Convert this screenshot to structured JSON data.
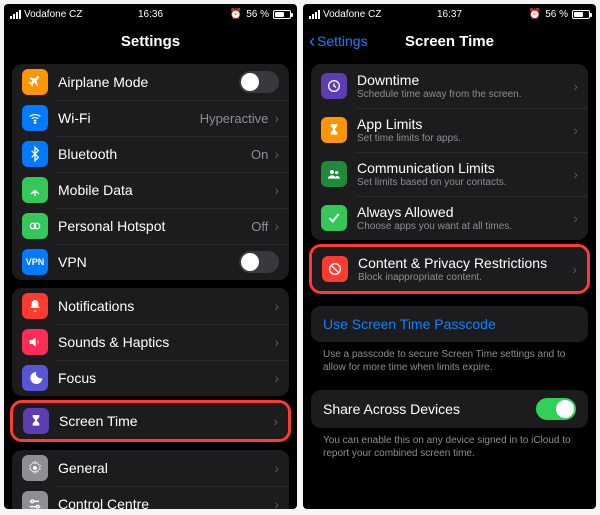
{
  "left": {
    "status": {
      "carrier": "Vodafone CZ",
      "time": "16:36",
      "battery_pct": "56 %"
    },
    "nav_title": "Settings",
    "group1": [
      {
        "icon": "airplane",
        "label": "Airplane Mode",
        "toggle": false
      },
      {
        "icon": "wifi",
        "label": "Wi-Fi",
        "value": "Hyperactive"
      },
      {
        "icon": "bluetooth",
        "label": "Bluetooth",
        "value": "On"
      },
      {
        "icon": "mobiledata",
        "label": "Mobile Data"
      },
      {
        "icon": "hotspot",
        "label": "Personal Hotspot",
        "value": "Off"
      },
      {
        "icon": "vpn",
        "label": "VPN",
        "toggle": false
      }
    ],
    "group2": [
      {
        "icon": "notify",
        "label": "Notifications"
      },
      {
        "icon": "sounds",
        "label": "Sounds & Haptics"
      },
      {
        "icon": "focus",
        "label": "Focus"
      }
    ],
    "screentime": {
      "icon": "hourglass",
      "label": "Screen Time"
    },
    "group3": [
      {
        "icon": "general",
        "label": "General"
      },
      {
        "icon": "control",
        "label": "Control Centre"
      }
    ]
  },
  "right": {
    "status": {
      "carrier": "Vodafone CZ",
      "time": "16:37",
      "battery_pct": "56 %"
    },
    "back_label": "Settings",
    "nav_title": "Screen Time",
    "items": [
      {
        "icon": "downtime",
        "label": "Downtime",
        "sub": "Schedule time away from the screen."
      },
      {
        "icon": "applimits",
        "label": "App Limits",
        "sub": "Set time limits for apps."
      },
      {
        "icon": "comm",
        "label": "Communication Limits",
        "sub": "Set limits based on your contacts."
      },
      {
        "icon": "always",
        "label": "Always Allowed",
        "sub": "Choose apps you want at all times."
      }
    ],
    "restrictions": {
      "label": "Content & Privacy Restrictions",
      "sub": "Block inappropriate content."
    },
    "passcode_link": "Use Screen Time Passcode",
    "passcode_footer": "Use a passcode to secure Screen Time settings and to allow for more time when limits expire.",
    "share_label": "Share Across Devices",
    "share_toggle": true,
    "share_footer": "You can enable this on any device signed in to iCloud to report your combined screen time."
  }
}
